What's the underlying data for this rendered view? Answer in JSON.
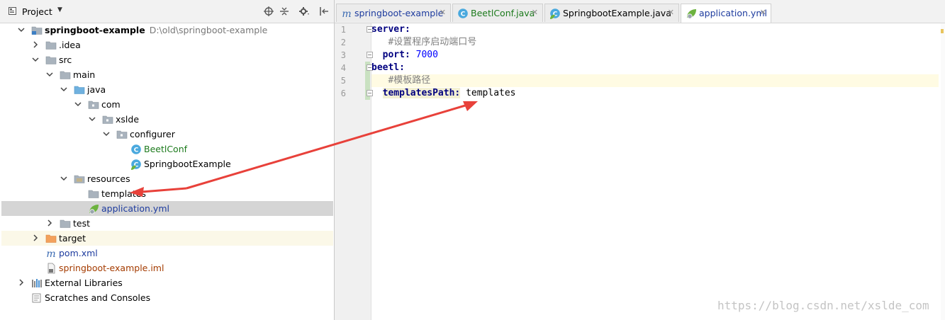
{
  "project_panel": {
    "title": "Project",
    "tree": [
      {
        "label": "springboot-example",
        "hint": "D:\\old\\springboot-example",
        "icon": "module-folder-icon",
        "depth": 0,
        "expanded": true,
        "bold": true
      },
      {
        "label": ".idea",
        "icon": "folder-icon",
        "depth": 1,
        "expanded": false
      },
      {
        "label": "src",
        "icon": "folder-icon",
        "depth": 1,
        "expanded": true
      },
      {
        "label": "main",
        "icon": "folder-icon",
        "depth": 2,
        "expanded": true
      },
      {
        "label": "java",
        "icon": "source-folder-icon",
        "depth": 3,
        "expanded": true
      },
      {
        "label": "com",
        "icon": "package-icon",
        "depth": 4,
        "expanded": true
      },
      {
        "label": "xslde",
        "icon": "package-icon",
        "depth": 5,
        "expanded": true
      },
      {
        "label": "configurer",
        "icon": "package-icon",
        "depth": 6,
        "expanded": true
      },
      {
        "label": "BeetlConf",
        "icon": "java-class-icon",
        "depth": 7,
        "color": "#1c7a1c"
      },
      {
        "label": "SpringbootExample",
        "icon": "spring-class-icon",
        "depth": 7
      },
      {
        "label": "resources",
        "icon": "resources-folder-icon",
        "depth": 3,
        "expanded": true
      },
      {
        "label": "templates",
        "icon": "folder-icon",
        "depth": 4
      },
      {
        "label": "application.yml",
        "icon": "yaml-file-icon",
        "depth": 4,
        "color": "#1d3b9e",
        "selected": true
      },
      {
        "label": "test",
        "icon": "folder-icon",
        "depth": 2,
        "expanded": false
      },
      {
        "label": "target",
        "icon": "excluded-folder-icon",
        "depth": 1,
        "expanded": false,
        "excluded": true
      },
      {
        "label": "pom.xml",
        "icon": "maven-icon",
        "depth": 1,
        "color": "#1d3b9e"
      },
      {
        "label": "springboot-example.iml",
        "icon": "iml-file-icon",
        "depth": 1,
        "color": "#a43b00"
      },
      {
        "label": "External Libraries",
        "icon": "libraries-icon",
        "depth": 0,
        "expanded": false
      },
      {
        "label": "Scratches and Consoles",
        "icon": "scratches-icon",
        "depth": 0
      }
    ]
  },
  "editor": {
    "tabs": [
      {
        "label": "springboot-example",
        "icon": "maven-icon",
        "color": "#1d3b9e"
      },
      {
        "label": "BeetlConf.java",
        "icon": "java-class-icon",
        "color": "#1c7a1c"
      },
      {
        "label": "SpringbootExample.java",
        "icon": "spring-class-icon",
        "color": "#000000"
      },
      {
        "label": "application.yml",
        "icon": "yaml-file-icon",
        "color": "#1d3b9e",
        "active": true
      }
    ],
    "line_numbers": [
      "1",
      "2",
      "3",
      "4",
      "5",
      "6"
    ],
    "code": {
      "l1_key": "server:",
      "l2_comment": "#设置程序启动端口号",
      "l3_key": "port:",
      "l3_value": "7000",
      "l4_key": "beetl:",
      "l5_comment": "#模板路径",
      "l6_key": "templatesPath:",
      "l6_value": "templates"
    }
  },
  "watermark": "https://blog.csdn.net/xslde_com",
  "colors": {
    "annotation_arrow": "#e8413a",
    "selection": "#d5d5d5",
    "yaml_key": "#000080",
    "yaml_number": "#0000ff",
    "comment": "#808080"
  }
}
